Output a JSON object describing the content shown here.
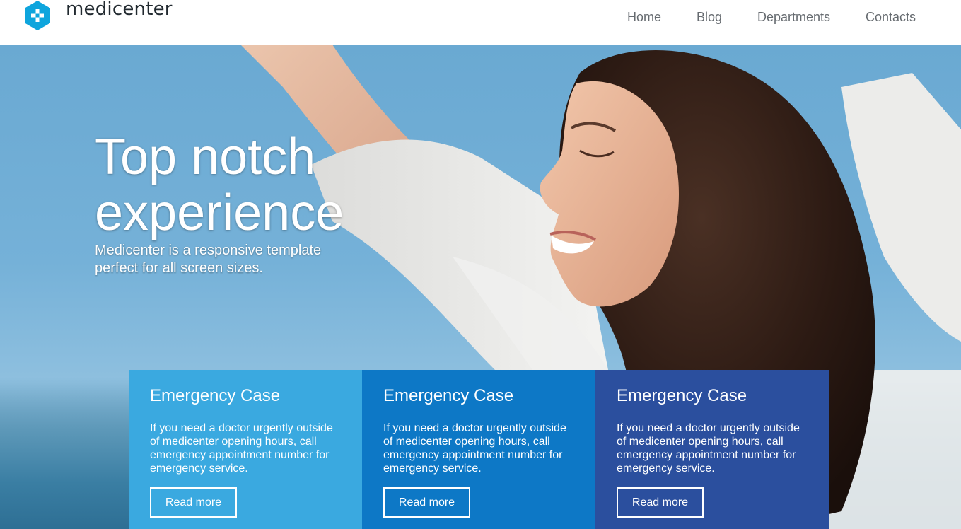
{
  "brand": {
    "name": "medicenter",
    "logo_icon": "cross-hexagon-icon",
    "accent": "#0ea5dd"
  },
  "nav": {
    "items": [
      {
        "label": "Home"
      },
      {
        "label": "Blog"
      },
      {
        "label": "Departments"
      },
      {
        "label": "Contacts"
      }
    ]
  },
  "hero": {
    "title_line1": "Top notch",
    "title_line2": "experience",
    "subtitle_line1": "Medicenter is a responsive template",
    "subtitle_line2": "perfect for all screen sizes."
  },
  "cards": [
    {
      "title": "Emergency Case",
      "text": "If you need a doctor urgently outside of medicenter opening hours, call emergency appointment number for emergency service.",
      "button": "Read more",
      "color": "#3aa9e0"
    },
    {
      "title": "Emergency Case",
      "text": "If you need a doctor urgently outside of medicenter opening hours, call emergency appointment number for emergency service.",
      "button": "Read more",
      "color": "#0d78c6"
    },
    {
      "title": "Emergency Case",
      "text": "If you need a doctor urgently outside of medicenter opening hours, call emergency appointment number for emergency service.",
      "button": "Read more",
      "color": "#2b4f9e"
    }
  ]
}
